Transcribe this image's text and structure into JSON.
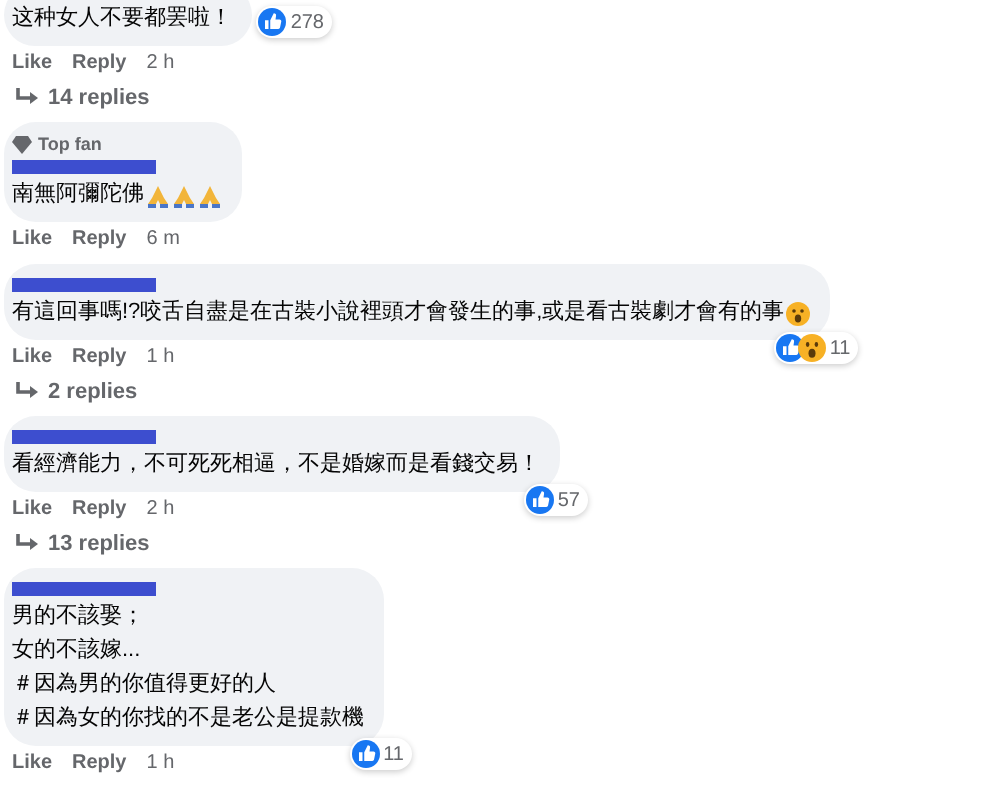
{
  "comments": [
    {
      "top_fan": false,
      "redacted_name": false,
      "lines": [
        "这种女人不要都罢啦！"
      ],
      "prayer_emojis": false,
      "surprised_emoji": false,
      "wow_reaction": false,
      "reaction_count": "278",
      "actions": [
        "Like",
        "Reply",
        "2 h"
      ],
      "replies": "14 replies"
    },
    {
      "top_fan": true,
      "top_fan_label": "Top fan",
      "redacted_name": true,
      "lines": [
        "南無阿彌陀佛"
      ],
      "prayer_emojis": true,
      "surprised_emoji": false,
      "actions": [
        "Like",
        "Reply",
        "6 m"
      ]
    },
    {
      "top_fan": false,
      "redacted_name": true,
      "lines": [
        "有這回事嗎!?咬舌自盡是在古裝小說裡頭才會發生的事,或是看古裝劇才會有的事"
      ],
      "prayer_emojis": false,
      "surprised_emoji": true,
      "wow_reaction": true,
      "reaction_count": "11",
      "actions": [
        "Like",
        "Reply",
        "1 h"
      ],
      "replies": "2 replies"
    },
    {
      "top_fan": false,
      "redacted_name": true,
      "lines": [
        "看經濟能力，不可死死相逼，不是婚嫁而是看錢交易！"
      ],
      "prayer_emojis": false,
      "surprised_emoji": false,
      "wow_reaction": false,
      "reaction_count": "57",
      "actions": [
        "Like",
        "Reply",
        "2 h"
      ],
      "replies": "13 replies"
    },
    {
      "top_fan": false,
      "redacted_name": true,
      "lines": [
        "男的不該娶；",
        "女的不該嫁...",
        "＃因為男的你值得更好的人",
        "＃因為女的你找的不是老公是提款機"
      ],
      "prayer_emojis": false,
      "surprised_emoji": false,
      "wow_reaction": false,
      "reaction_count": "11",
      "actions": [
        "Like",
        "Reply",
        "1 h"
      ]
    }
  ]
}
